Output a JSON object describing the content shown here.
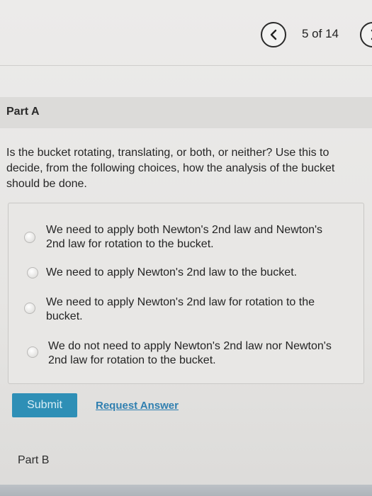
{
  "nav": {
    "counter": "5 of 14",
    "prev_icon": "chevron-left-icon",
    "next_icon": "chevron-right-icon"
  },
  "part_a": {
    "label": "Part A",
    "question": "Is the bucket rotating, translating, or both, or neither? Use this to decide, from the following choices, how the analysis of the bucket should be done.",
    "options": [
      {
        "text": "We need to apply both Newton's 2nd law and Newton's 2nd law for rotation to the bucket.",
        "selected": false
      },
      {
        "text": "We need to apply Newton's 2nd law to the bucket.",
        "selected": false
      },
      {
        "text": "We need to apply Newton's 2nd law for rotation to the bucket.",
        "selected": false
      },
      {
        "text": "We do not need to apply Newton's 2nd law nor Newton's 2nd law for rotation to the bucket.",
        "selected": false
      }
    ]
  },
  "actions": {
    "submit_label": "Submit",
    "request_answer_label": "Request Answer"
  },
  "part_b": {
    "label": "Part B"
  },
  "colors": {
    "submit_bg": "#2e8fb6",
    "link": "#2f7fb0"
  }
}
